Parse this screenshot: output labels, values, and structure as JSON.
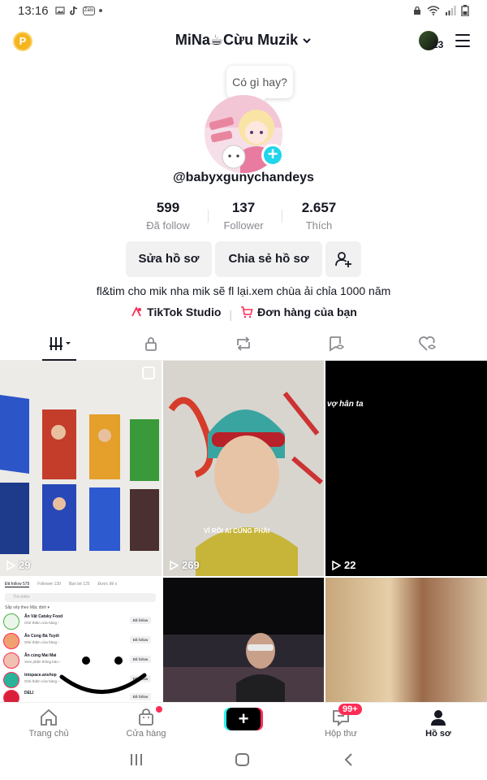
{
  "status_bar": {
    "time": "13:16",
    "left_icons": [
      "gallery-icon",
      "tiktok-icon",
      "zalo-icon"
    ],
    "zalo_label": "Zalo",
    "right_icons": [
      "lock-icon",
      "wifi-icon",
      "signal-icon",
      "battery-icon"
    ]
  },
  "header": {
    "coin_label": "P",
    "title": "MiNa☕Cừu Muzik",
    "notification_count": "23"
  },
  "profile": {
    "bubble_text": "Có gì hay?",
    "handle": "@babyxgunychandeys",
    "stats": [
      {
        "value": "599",
        "label": "Đã follow"
      },
      {
        "value": "137",
        "label": "Follower"
      },
      {
        "value": "2.657",
        "label": "Thích"
      }
    ],
    "buttons": {
      "edit": "Sửa hồ sơ",
      "share": "Chia sẻ hồ sơ"
    },
    "bio": "fl&tim cho mik nha mik sẽ fl lại.xem chùa ải chỉa 1000 năm",
    "links": [
      {
        "label": "TikTok Studio",
        "icon": "studio-icon"
      },
      {
        "label": "Đơn hàng của bạn",
        "icon": "cart-icon"
      }
    ]
  },
  "tabs": [
    "videos-grid",
    "private-lock",
    "reposts",
    "favorites",
    "liked"
  ],
  "videos": [
    {
      "views": "29",
      "overlay_text": ""
    },
    {
      "views": "269",
      "overlay_text": "VÌ RỒI AI CŨNG PHẢI"
    },
    {
      "views": "22",
      "overlay_text": "vợ hân ta"
    },
    {
      "views": "",
      "overlay_text": ""
    },
    {
      "views": "",
      "overlay_text": ""
    },
    {
      "views": "",
      "overlay_text": ""
    }
  ],
  "mini_list": {
    "tabs": [
      "Đã follow 579",
      "Follower 130",
      "Bạn bè 125",
      "Được đề x"
    ],
    "search_placeholder": "Tìm kiếm",
    "sort_label": "Sắp xếp theo Mặc định ▾",
    "rows": [
      {
        "name": "Ăn Vặt Catsky Food",
        "sub": "Ghé thăm cửa hàng ›",
        "btn": "Đã follow"
      },
      {
        "name": "Ăn Cùng Bà Tuyết",
        "sub": "Ghé thăm cửa hàng ›",
        "btn": "Đã follow"
      },
      {
        "name": "Ăn cùng Mai Mai",
        "sub": "Xem phần thông báo ›",
        "btn": "Đã follow"
      },
      {
        "name": "tntspace.anshop",
        "sub": "Ghé thăm cửa hàng ›",
        "btn": "Đã follow"
      },
      {
        "name": "DELI",
        "sub": "",
        "btn": "Đã follow"
      }
    ]
  },
  "bottom_nav": {
    "home": "Trang chủ",
    "shop": "Cửa hàng",
    "inbox": "Hộp thư",
    "inbox_badge": "99+",
    "profile": "Hồ sơ"
  },
  "colors": {
    "accent_red": "#fe2c55",
    "accent_cyan": "#20d5ec",
    "coin": "#f6b51e"
  }
}
